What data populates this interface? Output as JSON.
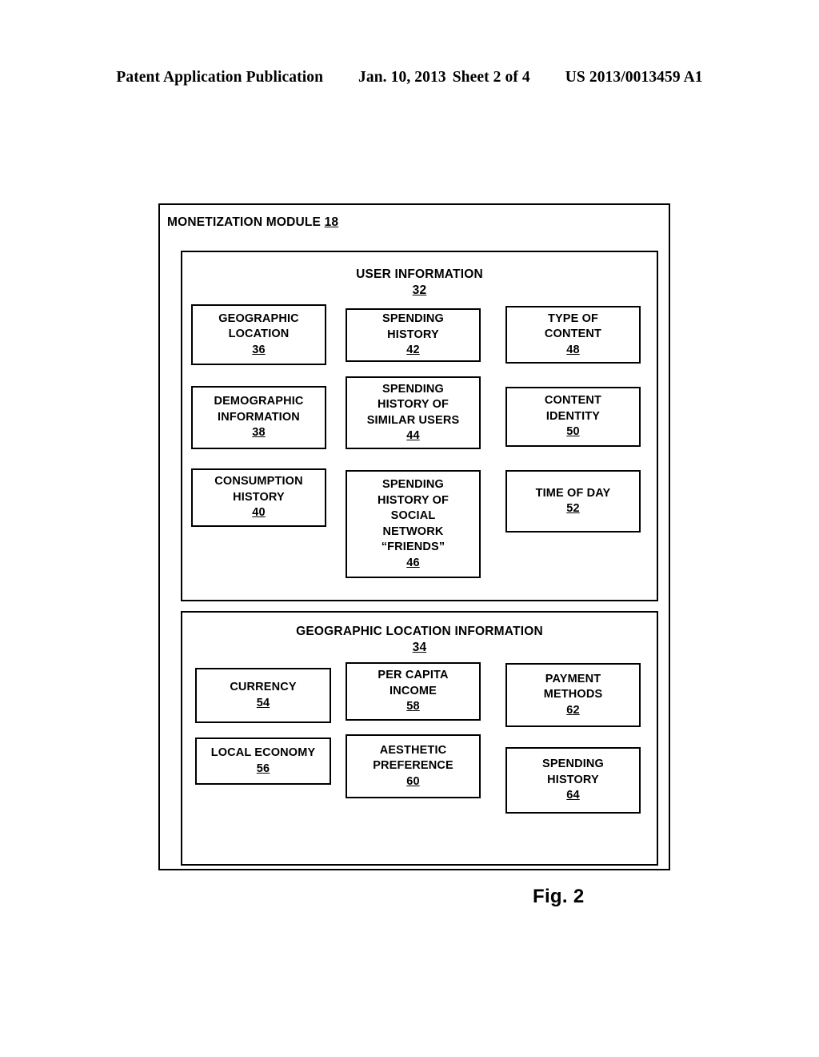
{
  "page_header": {
    "publication": "Patent Application Publication",
    "date": "Jan. 10, 2013",
    "sheet": "Sheet 2 of 4",
    "patent_number": "US 2013/0013459 A1"
  },
  "figure": {
    "caption": "Fig. 2"
  },
  "module": {
    "title": "MONETIZATION MODULE",
    "number": "18"
  },
  "sections": [
    {
      "id": "user-information",
      "title": "USER INFORMATION",
      "number": "32",
      "boxes": [
        {
          "id": "geographic-location",
          "label": "GEOGRAPHIC\nLOCATION",
          "number": "36"
        },
        {
          "id": "demographic-information",
          "label": "DEMOGRAPHIC\nINFORMATION",
          "number": "38"
        },
        {
          "id": "consumption-history",
          "label": "CONSUMPTION\nHISTORY",
          "number": "40"
        },
        {
          "id": "spending-history",
          "label": "SPENDING\nHISTORY",
          "number": "42"
        },
        {
          "id": "spending-history-similar-users",
          "label": "SPENDING\nHISTORY OF\nSIMILAR USERS",
          "number": "44"
        },
        {
          "id": "spending-history-social-network-friends",
          "label": "SPENDING\nHISTORY OF\nSOCIAL\nNETWORK\n“FRIENDS”",
          "number": "46"
        },
        {
          "id": "type-of-content",
          "label": "TYPE OF\nCONTENT",
          "number": "48"
        },
        {
          "id": "content-identity",
          "label": "CONTENT\nIDENTITY",
          "number": "50"
        },
        {
          "id": "time-of-day",
          "label": "TIME OF DAY",
          "number": "52"
        }
      ]
    },
    {
      "id": "geographic-location-information",
      "title": "GEOGRAPHIC LOCATION INFORMATION",
      "number": "34",
      "boxes": [
        {
          "id": "currency",
          "label": "CURRENCY",
          "number": "54"
        },
        {
          "id": "local-economy",
          "label": "LOCAL ECONOMY",
          "number": "56"
        },
        {
          "id": "per-capita-income",
          "label": "PER CAPITA\nINCOME",
          "number": "58"
        },
        {
          "id": "aesthetic-preference",
          "label": "AESTHETIC\nPREFERENCE",
          "number": "60"
        },
        {
          "id": "payment-methods",
          "label": "PAYMENT\nMETHODS",
          "number": "62"
        },
        {
          "id": "spending-history-geo",
          "label": "SPENDING\nHISTORY",
          "number": "64"
        }
      ]
    }
  ]
}
